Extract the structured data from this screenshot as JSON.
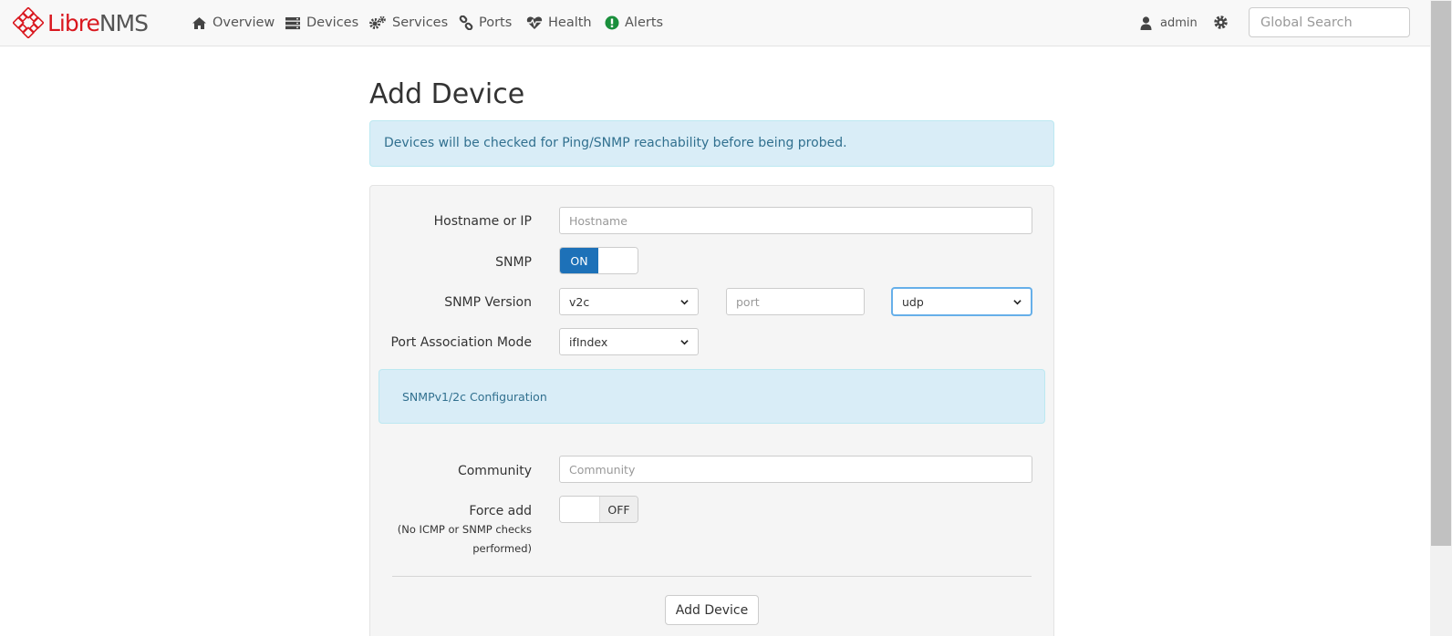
{
  "brand": {
    "part1": "Libre",
    "part2": "NMS"
  },
  "nav": {
    "items": [
      {
        "label": "Overview",
        "icon": "home-icon"
      },
      {
        "label": "Devices",
        "icon": "server-icon"
      },
      {
        "label": "Services",
        "icon": "cogs-icon"
      },
      {
        "label": "Ports",
        "icon": "link-icon"
      },
      {
        "label": "Health",
        "icon": "heartbeat-icon"
      },
      {
        "label": "Alerts",
        "icon": "exclamation-circle-icon"
      }
    ],
    "user": "admin",
    "search_placeholder": "Global Search"
  },
  "colors": {
    "accent": "#1d71b8",
    "brand_red": "#d9171e",
    "info_bg": "#d9edf7",
    "info_text": "#31708f",
    "alert_icon": "#1a8f3c"
  },
  "page": {
    "title": "Add Device",
    "info": "Devices will be checked for Ping/SNMP reachability before being probed."
  },
  "form": {
    "hostname_label": "Hostname or IP",
    "hostname_placeholder": "Hostname",
    "snmp_label": "SNMP",
    "snmp_toggle": "ON",
    "snmp_version_label": "SNMP Version",
    "snmp_version_value": "v2c",
    "port_placeholder": "port",
    "transport_value": "udp",
    "port_assoc_label": "Port Association Mode",
    "port_assoc_value": "ifIndex",
    "snmp_config_heading": "SNMPv1/2c Configuration",
    "community_label": "Community",
    "community_placeholder": "Community",
    "force_add_label": "Force add",
    "force_add_note_1": "(No ICMP or SNMP checks",
    "force_add_note_2": "performed)",
    "force_add_toggle": "OFF",
    "submit_label": "Add Device"
  }
}
